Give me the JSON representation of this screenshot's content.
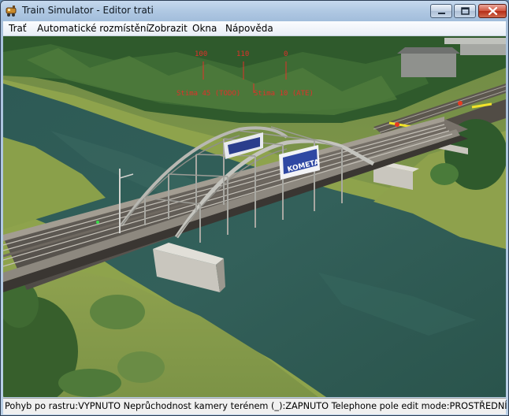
{
  "window": {
    "title": "Train Simulator - Editor trati",
    "icon": "train-app-icon",
    "controls": [
      "minimize-icon",
      "maximize-icon",
      "close-icon"
    ]
  },
  "menubar": {
    "items": [
      {
        "label": "Trať"
      },
      {
        "label": "Automatické rozmístění"
      },
      {
        "label": "Zobrazit"
      },
      {
        "label": "Okna"
      },
      {
        "label": "Nápověda"
      }
    ]
  },
  "viewport": {
    "banner_text": "KOMETA",
    "speed_markers": [
      "100",
      "110",
      "0"
    ],
    "track_labels": [
      "Stima 45 (TODO)",
      "Stima 10 (ATE)"
    ]
  },
  "statusbar": {
    "text": "Pohyb po rastru:VYPNUTO Neprůchodnost kamery terénem (_):ZAPNUTO Telephone pole edit mode:PROSTŘEDNÍ"
  },
  "colors": {
    "accent": "#a2bddb",
    "close": "#c13a21",
    "overlay_text": "#e0302a",
    "water": "#2f5b52",
    "grass": "#8ea34c"
  }
}
